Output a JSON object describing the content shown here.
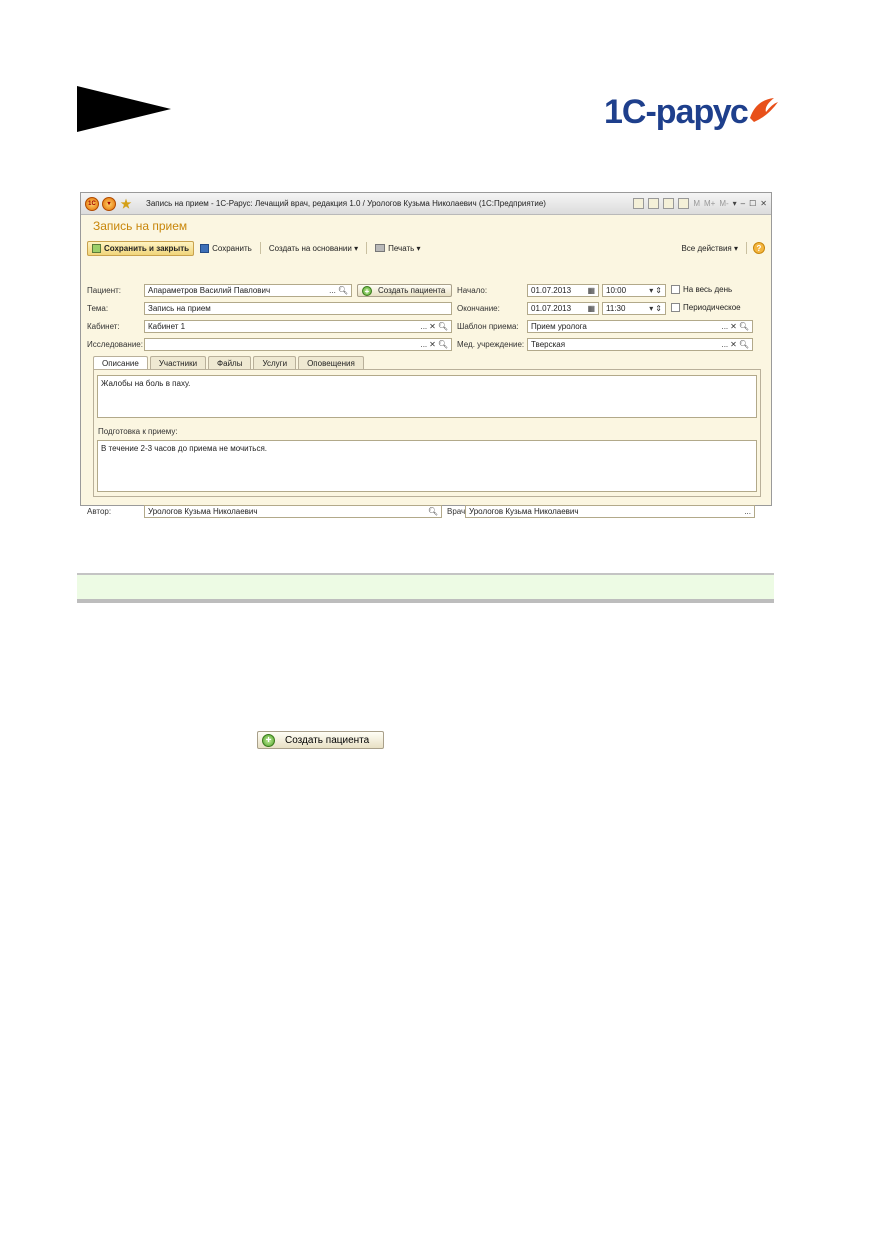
{
  "logo": {
    "text": "1С-рарус"
  },
  "window": {
    "title": "Запись на прием - 1С-Рарус: Лечащий врач, редакция 1.0 / Урологов Кузьма Николаевич (1С:Предприятие)",
    "titlebar_right": {
      "m": "M",
      "mplus": "M+",
      "mminus": "M-"
    },
    "form_title": "Запись на прием",
    "toolbar": {
      "save_close": "Сохранить и закрыть",
      "save": "Сохранить",
      "create_based": "Создать на основании",
      "print": "Печать",
      "all_actions": "Все действия",
      "help": "?"
    },
    "fields": {
      "patient_label": "Пациент:",
      "patient_value": "Апараметров Василий Павлович",
      "create_patient": "Создать пациента",
      "topic_label": "Тема:",
      "topic_value": "Запись на прием",
      "cabinet_label": "Кабинет:",
      "cabinet_value": "Кабинет 1",
      "study_label": "Исследование:",
      "study_value": "",
      "start_label": "Начало:",
      "start_date": "01.07.2013",
      "start_time": "10:00",
      "allday": "На весь день",
      "end_label": "Окончание:",
      "end_date": "01.07.2013",
      "end_time": "11:30",
      "periodic": "Периодическое",
      "template_label": "Шаблон приема:",
      "template_value": "Прием уролога",
      "med_label": "Мед. учреждение:",
      "med_value": "Тверская"
    },
    "tabs": [
      "Описание",
      "Участники",
      "Файлы",
      "Услуги",
      "Оповещения"
    ],
    "description_text": "Жалобы на боль в паху.",
    "prep_label": "Подготовка к приему:",
    "prep_text": "В течение 2-3 часов до приема не мочиться.",
    "author_label": "Автор:",
    "author_value": "Урологов Кузьма Николаевич",
    "doctor_label": "Врач:",
    "doctor_value": "Урологов Кузьма Николаевич"
  },
  "standalone_button": "Создать пациента",
  "icons": [
    "arrow",
    "logo-swoosh",
    "save-icon",
    "disk-icon",
    "print-icon",
    "plus-icon",
    "search-icon",
    "clear-icon",
    "calendar-icon"
  ]
}
